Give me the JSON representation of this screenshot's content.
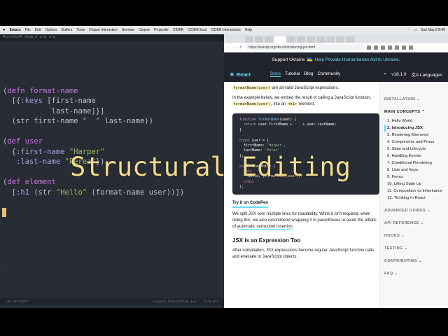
{
  "menubar": {
    "items": [
      "Emacs",
      "File",
      "Edit",
      "Options",
      "Buffers",
      "Tools",
      "Clojure Interaction",
      "Seeman",
      "Clojure",
      "Projectile",
      "CIDER",
      "CIDER Eval",
      "CIDER Interactions",
      "Help"
    ],
    "clock": "Sun May 8  8:40"
  },
  "emacs": {
    "header": [
      "#scratch#",
      "doom.d",
      "org",
      "org"
    ],
    "modeline_left": "<I>-scratch*",
    "modeline_mode": "Clojure Interaction [+]",
    "modeline_pos": "21:0 All"
  },
  "code": {
    "l1_paren": "(",
    "l1_kw": "defn",
    "l1_name": "format-name",
    "l2_open": "  [{",
    "l2_key": ":keys",
    "l2_rest": " [first-name",
    "l3": "           last-name]}]",
    "l4_a": "  (str first-name ",
    "l4_s": "\"  \"",
    "l4_b": " last-name))",
    "l6_paren": "(",
    "l6_kw": "def",
    "l6_name": "user",
    "l7_open": "  {",
    "l7_key": ":first-name",
    "l7_val": "\"Harper\"",
    "l8_key": "   :last-name",
    "l8_val": "\"Perez\"",
    "l8_close": "})",
    "l10_paren": "(",
    "l10_kw": "def",
    "l10_name": "element",
    "l11_open": "  [",
    "l11_key": ":h1",
    "l11_a": " (str ",
    "l11_s": "\"Hello\"",
    "l11_b": " (format-name user))])"
  },
  "browser": {
    "url": "https://reactjs.org/docs/introducing-jsx.html",
    "support_text": "Support Ukraine",
    "support_flag": "🇺🇦",
    "support_link": "Help Provide Humanitarian Aid to Ukraine.",
    "logo": "React",
    "nav_links": [
      "Docs",
      "Tutorial",
      "Blog",
      "Community"
    ],
    "version": "v18.1.0",
    "languages": "Languages"
  },
  "content": {
    "p0_code": "formatName(user)",
    "p0_rest": " are all valid JavaScript expressions.",
    "p1_a": "In the example below, we embed the result of calling a JavaScript function, ",
    "p1_code1": "formatName(user)",
    "p1_b": ", into an ",
    "p1_code2": "<h1>",
    "p1_c": " element.",
    "try_link": "Try it on CodePen",
    "p2_a": "We split JSX over multiple lines for readability. While it isn't required, when doing this, we also recommend wrapping it in parentheses to avoid the pitfalls of ",
    "p2_link": "automatic semicolon insertion",
    "p2_b": ".",
    "h2": "JSX is an Expression Too",
    "p3": "After compilation, JSX expressions become regular JavaScript function calls and evaluate to JavaScript objects."
  },
  "sidebar": {
    "installation": "INSTALLATION",
    "main_concepts": "MAIN CONCEPTS",
    "items": [
      "1. Hello World",
      "2. Introducing JSX",
      "3. Rendering Elements",
      "4. Components and Props",
      "5. State and Lifecycle",
      "6. Handling Events",
      "7. Conditional Rendering",
      "8. Lists and Keys",
      "9. Forms",
      "10. Lifting State Up",
      "11. Composition vs Inheritance",
      "12. Thinking In React"
    ],
    "sections_after": [
      "ADVANCED GUIDES",
      "API REFERENCE",
      "HOOKS",
      "TESTING",
      "CONTRIBUTING",
      "FAQ"
    ]
  },
  "overlay_title": "Structural Editing"
}
